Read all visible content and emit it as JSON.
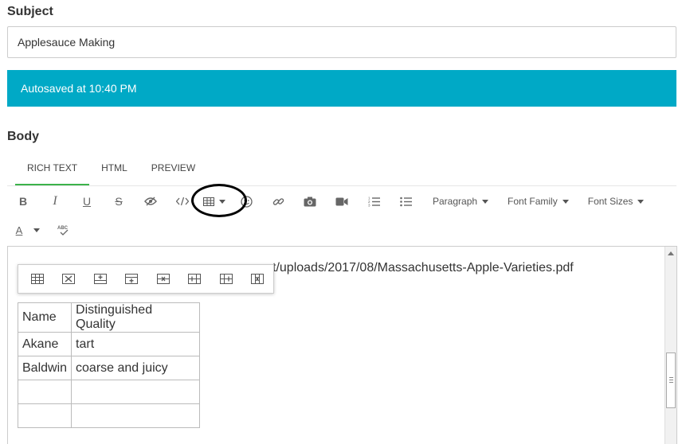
{
  "subject": {
    "label": "Subject",
    "value": "Applesauce Making"
  },
  "autosave": {
    "text": "Autosaved at 10:40 PM",
    "color": "#00a9c6"
  },
  "body": {
    "label": "Body"
  },
  "tabs": [
    {
      "label": "RICH TEXT",
      "active": true
    },
    {
      "label": "HTML",
      "active": false
    },
    {
      "label": "PREVIEW",
      "active": false
    }
  ],
  "toolbar": {
    "paragraph_label": "Paragraph",
    "font_family_label": "Font Family",
    "font_sizes_label": "Font Sizes"
  },
  "editor": {
    "url_text": "t/uploads/2017/08/Massachusetts-Apple-Varieties.pdf",
    "table": [
      [
        "Name",
        "Distinguished Quality"
      ],
      [
        "Akane",
        "tart"
      ],
      [
        "Baldwin",
        "coarse and juicy"
      ],
      [
        "",
        ""
      ],
      [
        "",
        ""
      ]
    ]
  },
  "colors": {
    "accent": "#00a9c6",
    "tab_active": "#3cb34a",
    "highlight_ring": "#000000"
  }
}
